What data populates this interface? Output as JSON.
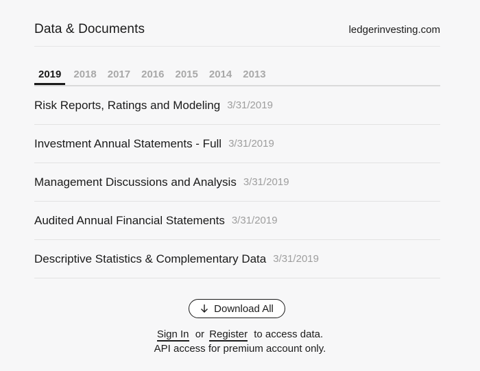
{
  "header": {
    "title": "Data & Documents",
    "site": "ledgerinvesting.com"
  },
  "tabs": [
    {
      "label": "2019",
      "active": true
    },
    {
      "label": "2018",
      "active": false
    },
    {
      "label": "2017",
      "active": false
    },
    {
      "label": "2016",
      "active": false
    },
    {
      "label": "2015",
      "active": false
    },
    {
      "label": "2014",
      "active": false
    },
    {
      "label": "2013",
      "active": false
    }
  ],
  "documents": [
    {
      "name": "Risk Reports, Ratings and Modeling",
      "date": "3/31/2019"
    },
    {
      "name": "Investment Annual Statements - Full",
      "date": "3/31/2019"
    },
    {
      "name": "Management Discussions and Analysis",
      "date": "3/31/2019"
    },
    {
      "name": "Audited Annual Financial Statements",
      "date": "3/31/2019"
    },
    {
      "name": "Descriptive Statistics & Complementary Data",
      "date": "3/31/2019"
    }
  ],
  "download": {
    "label": "Download All",
    "icon": "arrow-down-icon"
  },
  "access": {
    "sign_in": "Sign In",
    "or": "or",
    "register": "Register",
    "suffix": "to access data.",
    "note": "API access for premium account only."
  }
}
